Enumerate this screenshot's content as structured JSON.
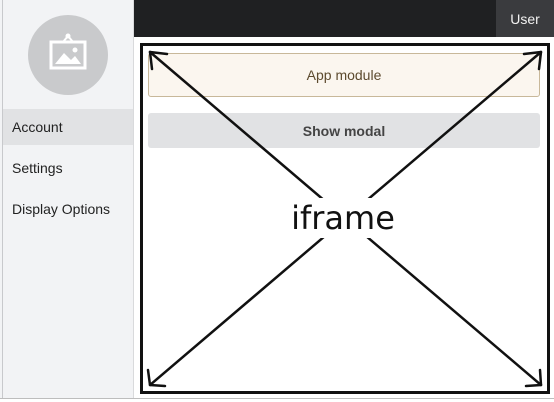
{
  "header": {
    "user_label": "User"
  },
  "sidebar": {
    "avatar_icon": "image-placeholder-icon",
    "items": [
      {
        "label": "Account",
        "active": true
      },
      {
        "label": "Settings",
        "active": false
      },
      {
        "label": "Display Options",
        "active": false
      }
    ]
  },
  "main": {
    "app_module_label": "App module",
    "show_modal_label": "Show modal",
    "iframe_label": "iframe"
  },
  "colors": {
    "topbar": "#1f2022",
    "sidebar_bg": "#f2f3f5",
    "active_item": "#e1e2e4",
    "app_module_bg": "#fbf6ef",
    "app_module_border": "#c8b89a"
  }
}
